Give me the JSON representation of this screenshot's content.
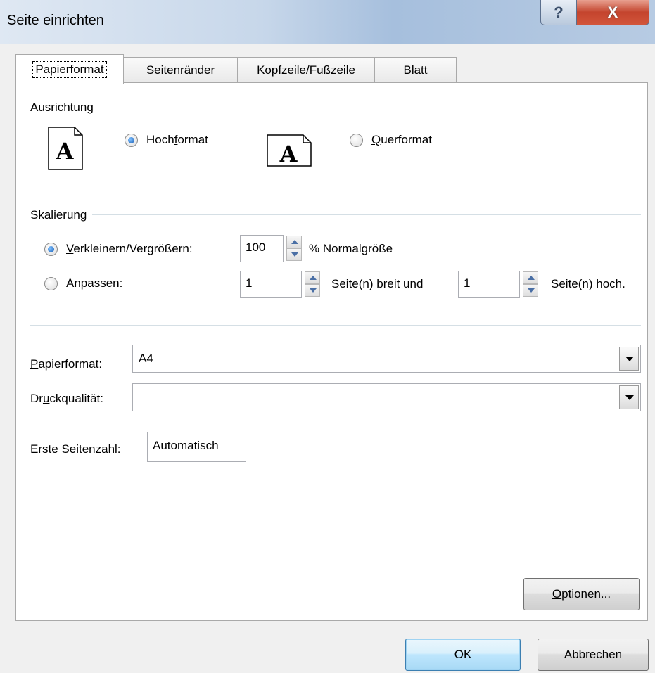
{
  "window": {
    "title": "Seite einrichten",
    "help_glyph": "?",
    "close_glyph": "X"
  },
  "tabs": [
    {
      "label": "Papierformat",
      "active": true
    },
    {
      "label": "Seitenränder",
      "active": false
    },
    {
      "label": "Kopfzeile/Fußzeile",
      "active": false
    },
    {
      "label": "Blatt",
      "active": false
    }
  ],
  "orientation": {
    "group_label": "Ausrichtung",
    "portrait": {
      "label_pre": "Hoch",
      "label_u": "f",
      "label_post": "ormat",
      "checked": true
    },
    "landscape": {
      "label_pre": "",
      "label_u": "Q",
      "label_post": "uerformat",
      "checked": false
    },
    "icon_glyph": "A"
  },
  "scaling": {
    "group_label": "Skalierung",
    "adjust": {
      "label_u": "V",
      "label_post": "erkleinern/Vergrößern:",
      "checked": true,
      "value": "100",
      "suffix": "% Normalgröße"
    },
    "fit": {
      "label_u": "A",
      "label_post": "npassen:",
      "checked": false,
      "wide_value": "1",
      "wide_suffix": "Seite(n) breit und",
      "tall_value": "1",
      "tall_suffix": "Seite(n) hoch."
    }
  },
  "paper_size": {
    "label_u": "P",
    "label_post": "apierformat:",
    "value": "A4"
  },
  "print_quality": {
    "label_pre": "Dr",
    "label_u": "u",
    "label_post": "ckqualität:",
    "value": ""
  },
  "first_page": {
    "label_pre": "Erste Seiten",
    "label_u": "z",
    "label_post": "ahl:",
    "value": "Automatisch"
  },
  "buttons": {
    "options": {
      "label_u": "O",
      "label_post": "ptionen..."
    },
    "ok": "OK",
    "cancel": "Abbrechen"
  }
}
